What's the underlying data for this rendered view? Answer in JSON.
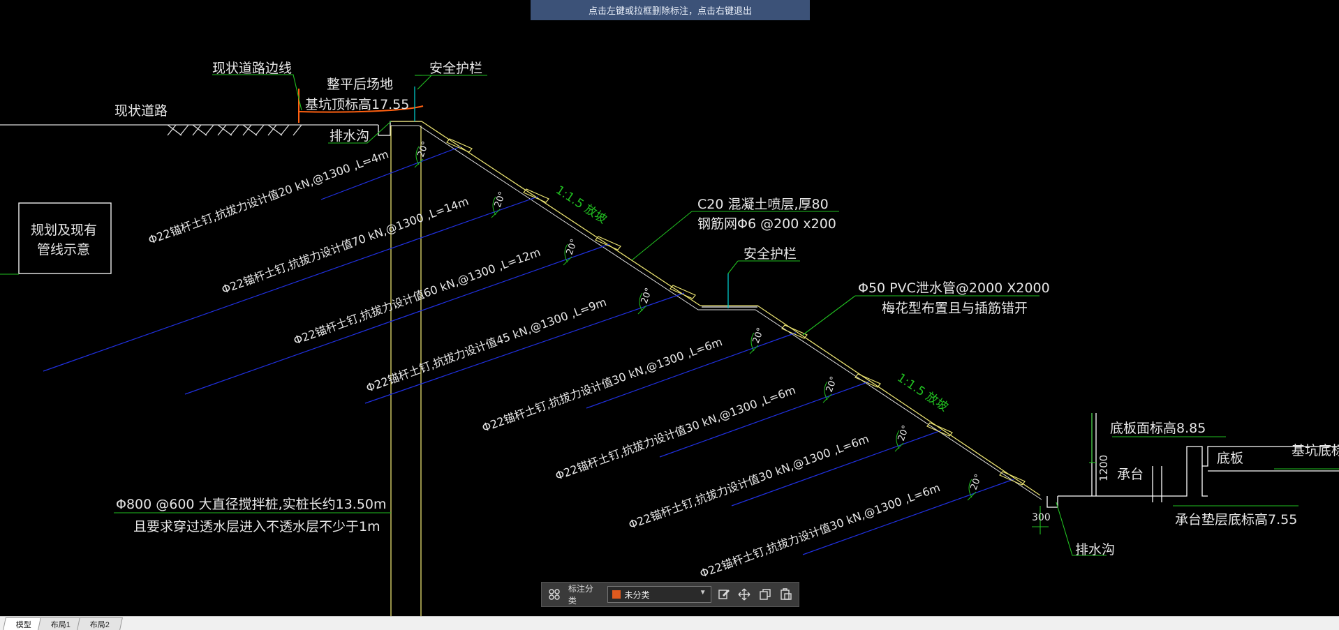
{
  "hint": "点击左键或拉框删除标注，点击右键退出",
  "drawing": {
    "existing_road_edge": "现状道路边线",
    "existing_road": "现状道路",
    "leveled_site": "整平后场地",
    "pit_top_elev": "基坑顶标高17.55",
    "guardrail_1": "安全护栏",
    "drain_1": "排水沟",
    "planned_pipeline_line1": "规划及现有",
    "planned_pipeline_line2": "管线示意",
    "slope_1": "1:1.5 放坡",
    "slope_2": "1:1.5 放坡",
    "shotcrete": "C20 混凝土喷层,厚80",
    "mesh": "钢筋网Φ6 @200 x200",
    "guardrail_2": "安全护栏",
    "pvc_pipe": "Φ50 PVC泄水管@2000 X2000",
    "pvc_note": "梅花型布置且与插筋错开",
    "angle": "20°",
    "nail_1": "Φ22锚杆土钉,抗拔力设计值20 kN,@1300 ,L=4m",
    "nail_2": "Φ22锚杆土钉,抗拔力设计值70 kN,@1300 ,L=14m",
    "nail_3": "Φ22锚杆土钉,抗拔力设计值60 kN,@1300 ,L=12m",
    "nail_4": "Φ22锚杆土钉,抗拔力设计值45 kN,@1300 ,L=9m",
    "nail_5": "Φ22锚杆土钉,抗拔力设计值30 kN,@1300 ,L=6m",
    "nail_6": "Φ22锚杆土钉,抗拔力设计值30 kN,@1300 ,L=6m",
    "nail_7": "Φ22锚杆土钉,抗拔力设计值30 kN,@1300 ,L=6m",
    "nail_8": "Φ22锚杆土钉,抗拔力设计值30 kN,@1300 ,L=6m",
    "pile": "Φ800 @600 大直径搅拌桩,实桩长约13.50m",
    "pile_note": "且要求穿过透水层进入不透水层不少于1m",
    "base_slab_elev": "底板面标高8.85",
    "dim_1200": "1200",
    "cap": "承台",
    "base_slab": "底板",
    "pit_bottom_elev": "基坑底标高",
    "cap_cushion_elev": "承台垫层底标高7.55",
    "dim_300": "300",
    "drain_2": "排水沟"
  },
  "toolbar": {
    "label": "标注分类",
    "category": "未分类",
    "category_color": "#e05a1e",
    "icons": [
      "grid-icon",
      "edit-icon",
      "move-icon",
      "copy-icon",
      "paste-icon"
    ]
  },
  "tabs": [
    "模型",
    "布局1",
    "布局2"
  ],
  "colors": {
    "background": "#000000",
    "structure": "#ffffff",
    "slope_face": "#e8e070",
    "annotation": "#21c021",
    "nail": "#2030e0",
    "guardrail": "#00c8c8",
    "ground_marker": "#ff6010",
    "hint_bar": "#3c5278"
  }
}
